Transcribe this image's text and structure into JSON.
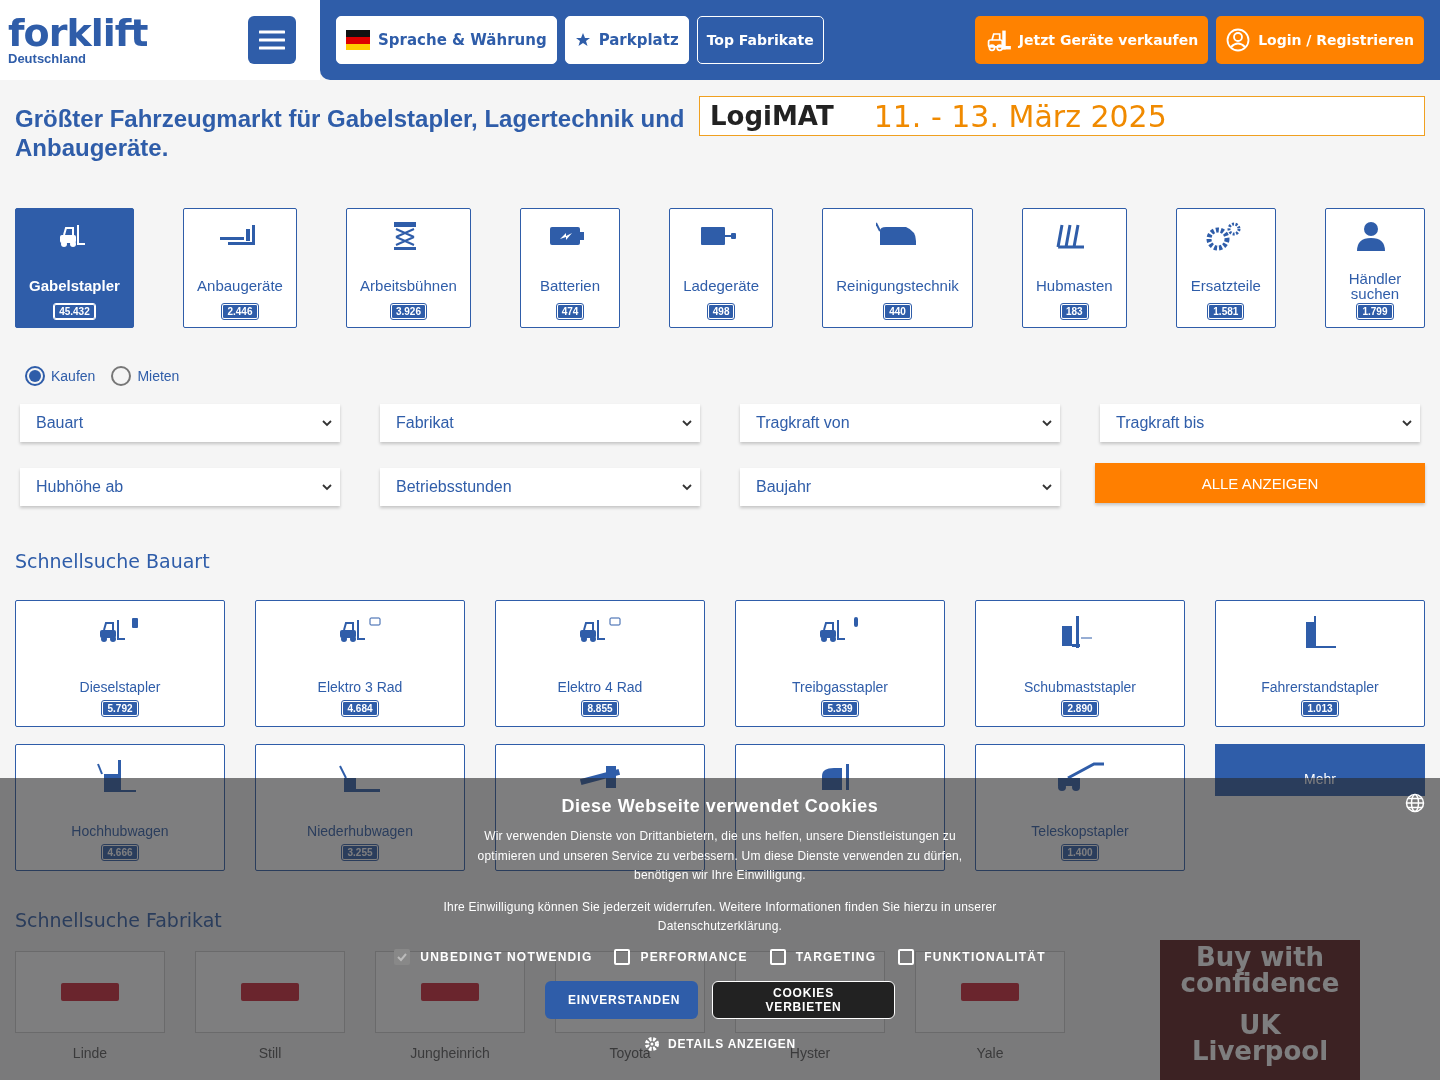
{
  "header": {
    "logo": {
      "wordmark": "forklift",
      "country": "Deutschland"
    },
    "nav": [
      {
        "kind": "language",
        "label": "Sprache & Währung"
      },
      {
        "kind": "favorite",
        "label": "Parkplatz"
      },
      {
        "kind": "outline",
        "label": "Top Fabrikate"
      }
    ],
    "actions": [
      {
        "kind": "sell",
        "label": "Jetzt Geräte verkaufen"
      },
      {
        "kind": "login",
        "label": "Login / Registrieren"
      }
    ]
  },
  "headline": "Größter Fahrzeugmarkt für Gabelstapler, Lagertechnik und Anbaugeräte.",
  "banner": {
    "brand": "LogiMAT",
    "dates": "11. - 13. März 2025"
  },
  "categories": [
    {
      "label": "Gabelstapler",
      "count": "45.432",
      "selected": true
    },
    {
      "label": "Anbaugeräte",
      "count": "2.446",
      "selected": false
    },
    {
      "label": "Arbeitsbühnen",
      "count": "3.926",
      "selected": false
    },
    {
      "label": "Batterien",
      "count": "474",
      "selected": false
    },
    {
      "label": "Ladegeräte",
      "count": "498",
      "selected": false
    },
    {
      "label": "Reinigungstechnik",
      "count": "440",
      "selected": false
    },
    {
      "label": "Hubmasten",
      "count": "183",
      "selected": false
    },
    {
      "label": "Ersatzteile",
      "count": "1.581",
      "selected": false
    },
    {
      "label": "Händler suchen",
      "count": "1.799",
      "selected": false
    }
  ],
  "mode": [
    {
      "label": "Kaufen",
      "selected": true
    },
    {
      "label": "Mieten",
      "selected": false
    }
  ],
  "filters": [
    {
      "placeholder": "Bauart"
    },
    {
      "placeholder": "Fabrikat"
    },
    {
      "placeholder": "Tragkraft von"
    },
    {
      "placeholder": "Tragkraft bis"
    },
    {
      "placeholder": "Hubhöhe ab"
    },
    {
      "placeholder": "Betriebsstunden"
    },
    {
      "placeholder": "Baujahr"
    }
  ],
  "search_button": "ALLE ANZEIGEN",
  "quick_type": {
    "title": "Schnellsuche Bauart",
    "items": [
      {
        "label": "Dieselstapler",
        "count": "5.792"
      },
      {
        "label": "Elektro 3 Rad",
        "count": "4.684"
      },
      {
        "label": "Elektro 4 Rad",
        "count": "8.855"
      },
      {
        "label": "Treibgasstapler",
        "count": "5.339"
      },
      {
        "label": "Schubmaststapler",
        "count": "2.890"
      },
      {
        "label": "Fahrerstandstapler",
        "count": "1.013"
      },
      {
        "label": "Hochhubwagen",
        "count": "4.666"
      },
      {
        "label": "Niederhubwagen",
        "count": "3.255"
      },
      {
        "kind": "covered"
      },
      {
        "kind": "covered"
      },
      {
        "label": "Teleskopstapler",
        "count": "1.400"
      }
    ],
    "more": "Mehr"
  },
  "quick_brand": {
    "title": "Schnellsuche Fabrikat",
    "items": [
      {
        "label": "Linde"
      },
      {
        "label": "Still"
      },
      {
        "label": "Jungheinrich"
      },
      {
        "label": "Toyota"
      },
      {
        "label": "Hyster"
      },
      {
        "label": "Yale"
      }
    ]
  },
  "ad": {
    "headline": "Buy with confidence",
    "location": "UK Liverpool"
  },
  "cookie": {
    "title": "Diese Webseite verwendet Cookies",
    "text": "Wir verwenden Dienste von Drittanbietern, die uns helfen, unsere Dienstleistungen zu optimieren und unseren Service zu verbessern. Um diese Dienste verwenden zu dürfen, benötigen wir Ihre Einwilligung.",
    "note": "Ihre Einwilligung können Sie jederzeit widerrufen. Weitere Informationen finden Sie hierzu in unserer Datenschutzerklärung.",
    "options": [
      {
        "label": "UNBEDINGT NOTWENDIG",
        "checked": true,
        "disabled": true
      },
      {
        "label": "PERFORMANCE",
        "checked": false,
        "disabled": false
      },
      {
        "label": "TARGETING",
        "checked": false,
        "disabled": false
      },
      {
        "label": "FUNKTIONALITÄT",
        "checked": false,
        "disabled": false
      }
    ],
    "buttons": [
      {
        "kind": "primary",
        "label": "EINVERSTANDEN"
      },
      {
        "kind": "secondary",
        "label": "COOKIES VERBIETEN"
      }
    ],
    "details": "DETAILS ANZEIGEN"
  }
}
